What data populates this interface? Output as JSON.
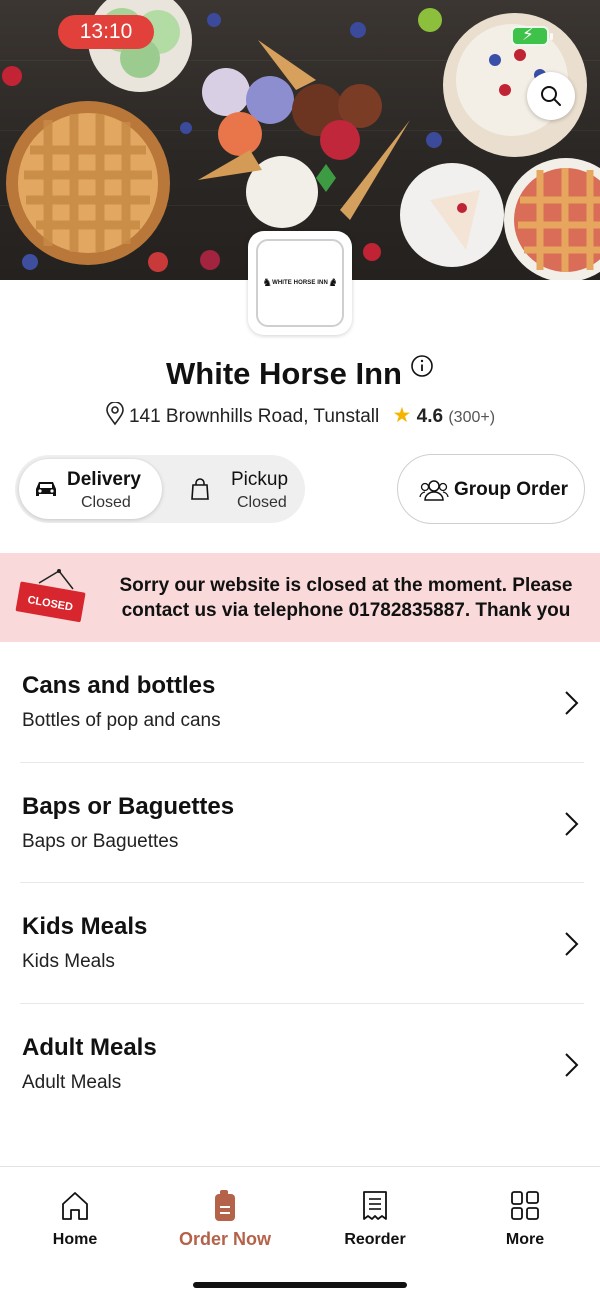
{
  "status_bar": {
    "time": "13:10"
  },
  "restaurant": {
    "logo_text": "WHITE HORSE INN",
    "name": "White Horse Inn",
    "address": "141 Brownhills Road, Tunstall",
    "rating": "4.6",
    "rating_count": "(300+)"
  },
  "order_modes": [
    {
      "label": "Delivery",
      "status": "Closed",
      "active": true
    },
    {
      "label": "Pickup",
      "status": "Closed",
      "active": false
    }
  ],
  "group_order": {
    "label": "Group Order"
  },
  "closed_banner": {
    "sign_text": "CLOSED",
    "message": "Sorry our website is closed at the moment. Please contact us via telephone 01782835887. Thank you"
  },
  "categories": [
    {
      "title": "Cans and bottles",
      "description": "Bottles of pop and cans"
    },
    {
      "title": "Baps or Baguettes",
      "description": "Baps or Baguettes"
    },
    {
      "title": "Kids Meals",
      "description": "Kids Meals"
    },
    {
      "title": "Adult Meals",
      "description": "Adult Meals"
    }
  ],
  "bottom_nav": [
    {
      "label": "Home",
      "icon": "home-icon",
      "active": false
    },
    {
      "label": "Order Now",
      "icon": "order-now-icon",
      "active": true
    },
    {
      "label": "Reorder",
      "icon": "receipt-icon",
      "active": false
    },
    {
      "label": "More",
      "icon": "grid-icon",
      "active": false
    }
  ],
  "colors": {
    "accent": "#b4624a",
    "closed_banner_bg": "#f9d9da",
    "closed_sign": "#d7262e",
    "star": "#f6b300",
    "time_pill": "#e2403a"
  }
}
